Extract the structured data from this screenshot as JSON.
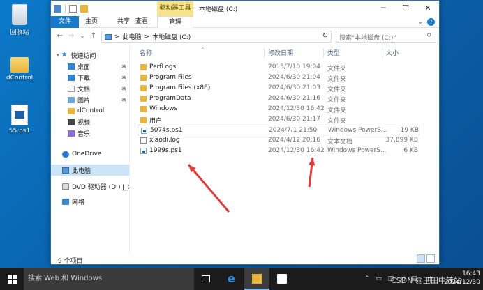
{
  "desktop": {
    "icons": [
      {
        "label": "回收站"
      },
      {
        "label": "dControl"
      },
      {
        "label": "55.ps1"
      }
    ]
  },
  "window": {
    "title": "本地磁盘 (C:)",
    "context_tab": "驱动器工具",
    "controls": {
      "minimize": "─",
      "maximize": "☐",
      "close": "✕"
    },
    "ribbon": {
      "tabs": [
        {
          "label": "文件"
        },
        {
          "label": "主页"
        },
        {
          "label": "共享"
        },
        {
          "label": "查看"
        },
        {
          "label": "管理"
        }
      ],
      "expand_glyph": "⌄",
      "help_glyph": "?"
    },
    "navigation": {
      "back": "←",
      "forward": "→",
      "recent": "⌄",
      "up": "↑",
      "path": [
        "此电脑",
        "本地磁盘 (C:)"
      ],
      "path_sep": ">",
      "dropdown": "⌄",
      "refresh": "↻"
    },
    "search": {
      "placeholder": "搜索\"本地磁盘 (C:)\"",
      "glyph": "⚲"
    },
    "sidebar": {
      "quick_access": "快速访问",
      "items": [
        {
          "label": "桌面",
          "pinned": "✱"
        },
        {
          "label": "下载",
          "pinned": "✱"
        },
        {
          "label": "文档",
          "pinned": "✱"
        },
        {
          "label": "图片",
          "pinned": "✱"
        },
        {
          "label": "dControl"
        },
        {
          "label": "视频"
        },
        {
          "label": "音乐"
        }
      ],
      "onedrive": "OneDrive",
      "this_pc": "此电脑",
      "dvd": "DVD 驱动器 (D:) J_CC",
      "network": "网络"
    },
    "columns": {
      "name": "名称",
      "date": "修改日期",
      "type": "类型",
      "size": "大小",
      "sort_caret": "^"
    },
    "files": [
      {
        "name": "PerfLogs",
        "date": "2015/7/10 19:04",
        "type": "文件夹",
        "size": "",
        "icon": "folder"
      },
      {
        "name": "Program Files",
        "date": "2024/6/30 21:04",
        "type": "文件夹",
        "size": "",
        "icon": "folder"
      },
      {
        "name": "Program Files (x86)",
        "date": "2024/6/30 21:03",
        "type": "文件夹",
        "size": "",
        "icon": "folder"
      },
      {
        "name": "ProgramData",
        "date": "2024/6/30 21:16",
        "type": "文件夹",
        "size": "",
        "icon": "folder"
      },
      {
        "name": "Windows",
        "date": "2024/12/30 16:42",
        "type": "文件夹",
        "size": "",
        "icon": "folder"
      },
      {
        "name": "用户",
        "date": "2024/6/30 21:17",
        "type": "文件夹",
        "size": "",
        "icon": "folder"
      },
      {
        "name": "5074s.ps1",
        "date": "2024/7/1 21:50",
        "type": "Windows PowerS...",
        "size": "19 KB",
        "icon": "ps1"
      },
      {
        "name": "xiaodi.log",
        "date": "2024/4/12 20:16",
        "type": "文本文档",
        "size": "37,899 KB",
        "icon": "text"
      },
      {
        "name": "1999s.ps1",
        "date": "2024/12/30 16:42",
        "type": "Windows PowerS...",
        "size": "6 KB",
        "icon": "ps1"
      }
    ],
    "status": {
      "count": "9 个项目"
    }
  },
  "taskbar": {
    "search_placeholder": "搜索 Web 和 Windows",
    "edge_glyph": "e",
    "tray": {
      "icons": "⌃ ▭ ◫ ◁ ▤",
      "ime": "中",
      "time": "16:43",
      "date": "2024/12/30"
    }
  },
  "watermark": "CSDN @玉田中转站",
  "colors": {
    "accent": "#1979ca",
    "arrow": "#e23b3b",
    "context_tab": "#f7e48a",
    "folder": "#e9b53a"
  }
}
